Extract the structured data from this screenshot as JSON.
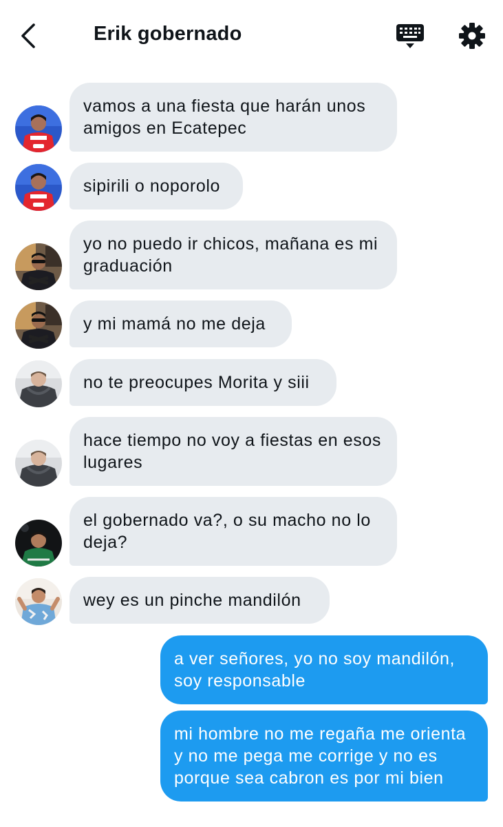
{
  "header": {
    "title": "Erik gobernado",
    "back_icon": "chevron-left-icon",
    "keyboard_icon": "keyboard-icon",
    "settings_icon": "gear-icon"
  },
  "colors": {
    "incoming_bubble": "#e7ebef",
    "outgoing_bubble": "#1d9bf0",
    "text": "#0f1419"
  },
  "messages": [
    {
      "direction": "in",
      "sender_avatar": "avatar-soccer-red",
      "text": "vamos a una fiesta que harán unos amigos en Ecatepec"
    },
    {
      "direction": "in",
      "sender_avatar": "avatar-soccer-red",
      "text": "sipirili o noporolo"
    },
    {
      "direction": "in",
      "sender_avatar": "avatar-dark-jacket",
      "text": "yo no puedo ir chicos, mañana es mi graduación"
    },
    {
      "direction": "in",
      "sender_avatar": "avatar-dark-jacket",
      "text": "y mi mamá no me deja"
    },
    {
      "direction": "in",
      "sender_avatar": "avatar-grey-hoodie",
      "text": "no te preocupes Morita y siii"
    },
    {
      "direction": "in",
      "sender_avatar": "avatar-grey-hoodie",
      "text": "hace tiempo no voy a fiestas en esos lugares"
    },
    {
      "direction": "in",
      "sender_avatar": "avatar-green-shirt",
      "text": "el gobernado va?, o su macho no lo deja?"
    },
    {
      "direction": "in",
      "sender_avatar": "avatar-blue-shirt",
      "text": "wey es un pinche mandilón"
    },
    {
      "direction": "out",
      "text": "a ver señores, yo no soy mandilón, soy responsable"
    },
    {
      "direction": "out",
      "text": "mi hombre no me regaña me orienta y no me pega me corrige y no es porque sea cabron es por mi bien"
    }
  ]
}
